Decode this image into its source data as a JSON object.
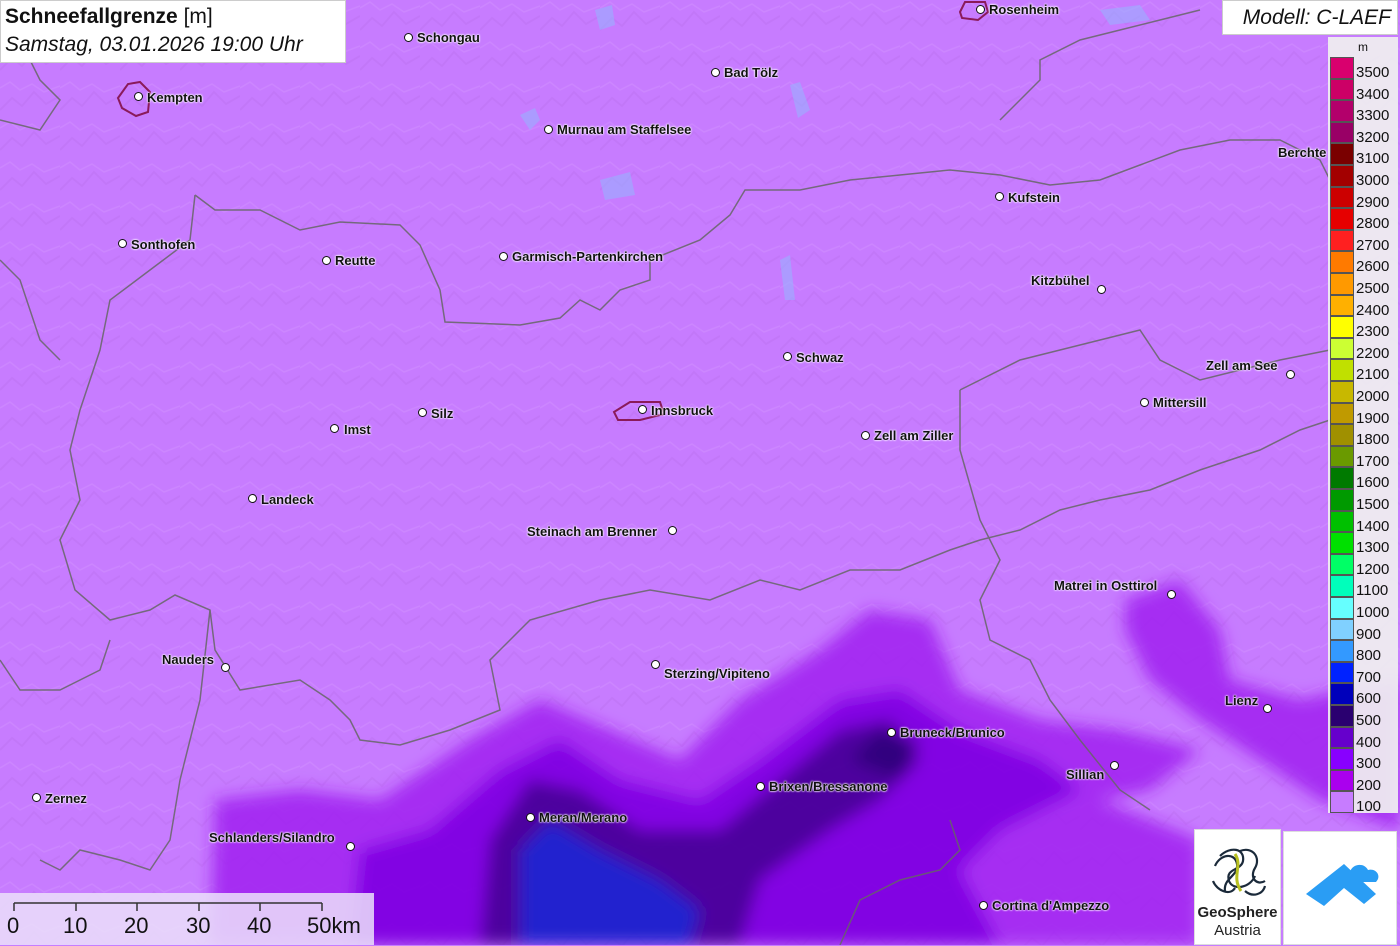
{
  "header": {
    "title_main": "Schneefallgrenze",
    "title_unit": "[m]",
    "datetime": "Samstag, 03.01.2026 19:00 Uhr",
    "model": "Modell: C-LAEF"
  },
  "legend": {
    "unit": "m",
    "levels": [
      {
        "label": "3500",
        "color": "#d9006e"
      },
      {
        "label": "3400",
        "color": "#cc0066"
      },
      {
        "label": "3300",
        "color": "#b3006b"
      },
      {
        "label": "3200",
        "color": "#990066"
      },
      {
        "label": "3100",
        "color": "#7a0000"
      },
      {
        "label": "3000",
        "color": "#a30000"
      },
      {
        "label": "2900",
        "color": "#cc0000"
      },
      {
        "label": "2800",
        "color": "#e60000"
      },
      {
        "label": "2700",
        "color": "#ff2020"
      },
      {
        "label": "2600",
        "color": "#ff7a00"
      },
      {
        "label": "2500",
        "color": "#ff9900"
      },
      {
        "label": "2400",
        "color": "#ffb000"
      },
      {
        "label": "2300",
        "color": "#ffff00"
      },
      {
        "label": "2200",
        "color": "#ccff33"
      },
      {
        "label": "2100",
        "color": "#c0e000"
      },
      {
        "label": "2000",
        "color": "#c8b800"
      },
      {
        "label": "1900",
        "color": "#c09a00"
      },
      {
        "label": "1800",
        "color": "#a09000"
      },
      {
        "label": "1700",
        "color": "#6a9a00"
      },
      {
        "label": "1600",
        "color": "#007a00"
      },
      {
        "label": "1500",
        "color": "#009a00"
      },
      {
        "label": "1400",
        "color": "#00c000"
      },
      {
        "label": "1300",
        "color": "#00e000"
      },
      {
        "label": "1200",
        "color": "#00ff66"
      },
      {
        "label": "1100",
        "color": "#00ffbb"
      },
      {
        "label": "1000",
        "color": "#66ffff"
      },
      {
        "label": "900",
        "color": "#80d0ff"
      },
      {
        "label": "800",
        "color": "#3399ff"
      },
      {
        "label": "700",
        "color": "#0022ff"
      },
      {
        "label": "600",
        "color": "#0000bb"
      },
      {
        "label": "500",
        "color": "#2a0070"
      },
      {
        "label": "400",
        "color": "#6600cc"
      },
      {
        "label": "300",
        "color": "#8800ff"
      },
      {
        "label": "200",
        "color": "#aa00ee"
      },
      {
        "label": "100",
        "color": "#c77cff"
      }
    ]
  },
  "cities": [
    {
      "name": "Rosenheim"
    },
    {
      "name": "Schongau"
    },
    {
      "name": "Bad Tölz"
    },
    {
      "name": "Kempten"
    },
    {
      "name": "Murnau am Staffelsee"
    },
    {
      "name": "Berchte"
    },
    {
      "name": "Kufstein"
    },
    {
      "name": "Sonthofen"
    },
    {
      "name": "Reutte"
    },
    {
      "name": "Garmisch-Partenkirchen"
    },
    {
      "name": "Kitzbühel"
    },
    {
      "name": "Schwaz"
    },
    {
      "name": "Zell am See"
    },
    {
      "name": "Mittersill"
    },
    {
      "name": "Silz"
    },
    {
      "name": "Innsbruck"
    },
    {
      "name": "Imst"
    },
    {
      "name": "Zell am Ziller"
    },
    {
      "name": "Landeck"
    },
    {
      "name": "Steinach am Brenner"
    },
    {
      "name": "Matrei in Osttirol"
    },
    {
      "name": "Nauders"
    },
    {
      "name": "Sterzing/Vipiteno"
    },
    {
      "name": "Lienz"
    },
    {
      "name": "Bruneck/Brunico"
    },
    {
      "name": "Sillian"
    },
    {
      "name": "Brixen/Bressanone"
    },
    {
      "name": "Zernez"
    },
    {
      "name": "Meran/Merano"
    },
    {
      "name": "Schlanders/Silandro"
    },
    {
      "name": "Cortina d'Ampezzo"
    }
  ],
  "scale_bar": {
    "labels": [
      "0",
      "10",
      "20",
      "30",
      "40",
      "50km"
    ]
  },
  "logos": {
    "geosphere_line1": "GeoSphere",
    "geosphere_line2": "Austria"
  }
}
